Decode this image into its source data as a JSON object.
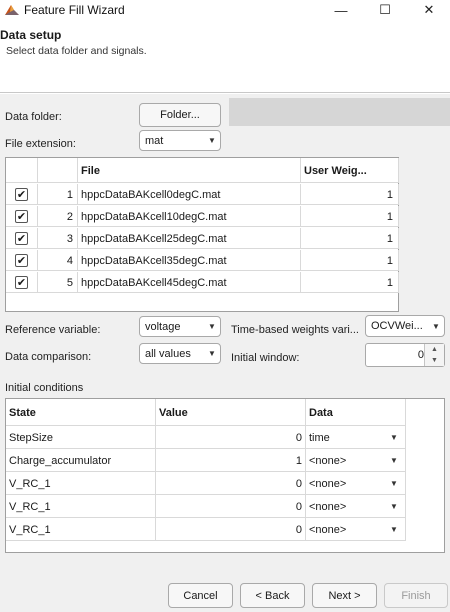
{
  "window": {
    "title": "Feature Fill Wizard",
    "minimize": "—",
    "maximize": "☐",
    "close": "✕"
  },
  "header": {
    "title": "Data setup",
    "subtitle": "Select data folder and signals."
  },
  "data_folder": {
    "label": "Data folder:",
    "button": "Folder..."
  },
  "file_extension": {
    "label": "File extension:",
    "value": "mat"
  },
  "file_table": {
    "columns": [
      "",
      "",
      "File",
      "User Weig..."
    ],
    "rows": [
      {
        "checked": true,
        "index": "1",
        "file": "hppcDataBAKcell0degC.mat",
        "weight": "1"
      },
      {
        "checked": true,
        "index": "2",
        "file": "hppcDataBAKcell10degC.mat",
        "weight": "1"
      },
      {
        "checked": true,
        "index": "3",
        "file": "hppcDataBAKcell25degC.mat",
        "weight": "1"
      },
      {
        "checked": true,
        "index": "4",
        "file": "hppcDataBAKcell35degC.mat",
        "weight": "1"
      },
      {
        "checked": true,
        "index": "5",
        "file": "hppcDataBAKcell45degC.mat",
        "weight": "1"
      }
    ]
  },
  "reference_variable": {
    "label": "Reference variable:",
    "value": "voltage"
  },
  "data_comparison": {
    "label": "Data comparison:",
    "value": "all values"
  },
  "time_weights": {
    "label": "Time-based weights vari...",
    "value": "OCVWei..."
  },
  "initial_window": {
    "label": "Initial window:",
    "value": "0"
  },
  "initial_conditions": {
    "label": "Initial conditions",
    "columns": [
      "State",
      "Value",
      "Data"
    ],
    "rows": [
      {
        "state": "StepSize",
        "value": "0",
        "data": "time"
      },
      {
        "state": "Charge_accumulator",
        "value": "1",
        "data": "<none>"
      },
      {
        "state": "V_RC_1",
        "value": "0",
        "data": "<none>"
      },
      {
        "state": "V_RC_1",
        "value": "0",
        "data": "<none>"
      },
      {
        "state": "V_RC_1",
        "value": "0",
        "data": "<none>"
      }
    ]
  },
  "footer": {
    "cancel": "Cancel",
    "back": "< Back",
    "next": "Next >",
    "finish": "Finish"
  },
  "icons": {
    "app": "matlab-icon",
    "dropdown": "chevron-down-icon",
    "check": "checkmark-icon"
  }
}
